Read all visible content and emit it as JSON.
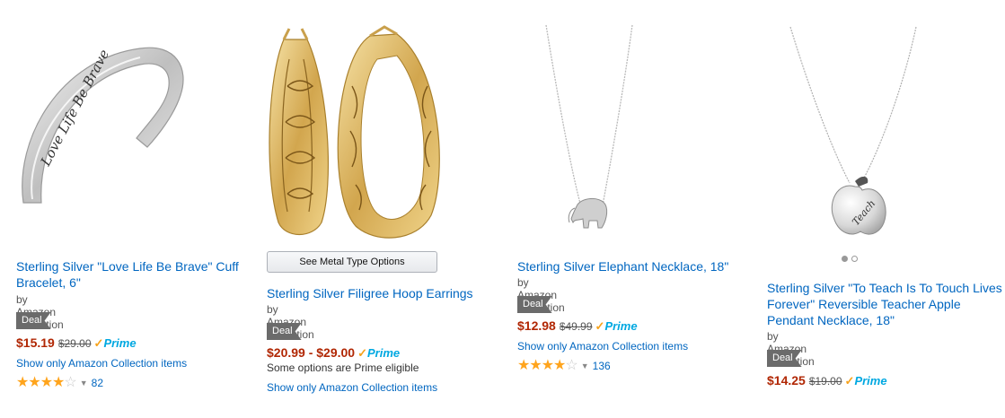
{
  "products": [
    {
      "title": "Sterling Silver \"Love Life Be Brave\" Cuff Bracelet, 6\"",
      "byline": "by Amazon Collection",
      "deal_badge": "Deal of the Day",
      "price": "$15.19",
      "list_price": "$29.00",
      "prime_label": "Prime",
      "seller_link": "Show only Amazon Collection items",
      "rating": 4.5,
      "review_count": "82",
      "engraving": "Love Life Be Brave"
    },
    {
      "metal_button": "See Metal Type Options",
      "title": "Sterling Silver Filigree Hoop Earrings",
      "byline": "by Amazon Collection",
      "deal_badge": "Deal of the Day",
      "price": "$20.99 - $29.00",
      "prime_label": "Prime",
      "prime_note": "Some options are Prime eligible",
      "seller_link": "Show only Amazon Collection items"
    },
    {
      "title": "Sterling Silver Elephant Necklace, 18\"",
      "byline": "by Amazon Collection",
      "deal_badge": "Deal of the Day",
      "price": "$12.98",
      "list_price": "$49.99",
      "prime_label": "Prime",
      "seller_link": "Show only Amazon Collection items",
      "rating": 4.5,
      "review_count": "136"
    },
    {
      "title": "Sterling Silver \"To Teach Is To Touch Lives Forever\" Reversible Teacher Apple Pendant Necklace, 18\"",
      "byline": "by Amazon Collection",
      "deal_badge": "Deal of the Day",
      "price": "$14.25",
      "list_price": "$19.00",
      "prime_label": "Prime",
      "pendant_text": "Teach",
      "image_dots": 2,
      "active_dot": 1
    }
  ]
}
